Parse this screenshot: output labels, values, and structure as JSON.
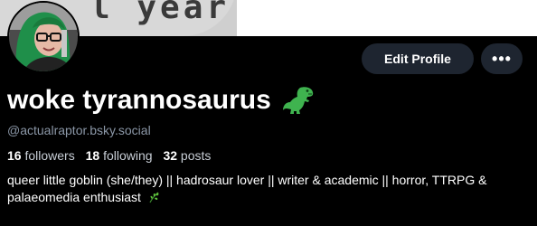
{
  "banner": {
    "text": "l year"
  },
  "buttons": {
    "edit_profile": "Edit Profile",
    "more": "•••"
  },
  "profile": {
    "display_name": "woke tyrannosaurus",
    "handle": "@actualraptor.bsky.social",
    "followers_count": "16",
    "followers_label": "followers",
    "following_count": "18",
    "following_label": "following",
    "posts_count": "32",
    "posts_label": "posts",
    "bio": "queer little goblin (she/they) || hadrosaur lover || writer & academic || horror, TTRPG & palaeomedia enthusiast"
  },
  "icons": {
    "name_emoji": "t-rex-emoji-icon",
    "bio_emoji": "herb-emoji-icon",
    "more": "more-options-icon"
  },
  "colors": {
    "accent_green": "#3fb34f",
    "button_bg": "#1e2530",
    "muted_text": "#8b97a7"
  }
}
